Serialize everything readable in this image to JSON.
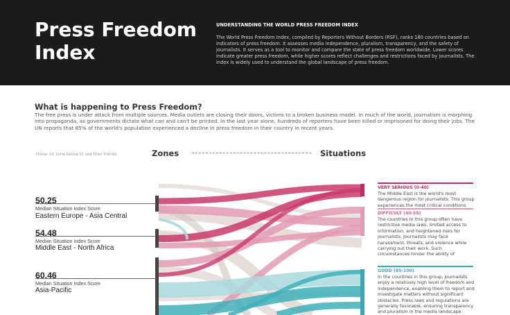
{
  "header": {
    "title": "Press Freedom Index",
    "subtitle": "UNDERSTANDING THE WORLD PRESS FREEDOM INDEX",
    "description": "The World Press Freedom Index, compiled by Reporters Without Borders (RSF), ranks 180 countries based on indicators of press freedom. It assesses media independence, pluralism, transparency, and the safety of journalists. It serves as a tool to monitor and compare the state of press freedom worldwide. Lower scores indicate greater press freedom, while higher scores reflect challenges and restrictions faced by journalists. The index is widely used to understand the global landscape of press freedom."
  },
  "intro": {
    "heading": "What is happening to Press Freedom?",
    "text": "The free press is under attack from multiple sources. Media outlets are closing their doors, victims to a broken business model. In much of the world, journalism is morphing into propaganda, as governments dictate what can and can't be printed. In the last year alone, hundreds of reporters have been killed or imprisoned for doing their jobs. The UN reports that 85% of the world's population experienced a decline in press freedom in their country in recent years."
  },
  "chart": {
    "hint": "Hover on zone below to see their trends",
    "zones_heading": "Zones",
    "situations_heading": "Situations",
    "zones": [
      {
        "score": "50.25",
        "caption": "Median Situation Index Score",
        "name": "Eastern Europe - Asia Central"
      },
      {
        "score": "54.48",
        "caption": "Median Situation Index Score",
        "name": "Middle East - North Africa"
      },
      {
        "score": "60.46",
        "caption": "Median Situation Index Score",
        "name": "Asia-Pacific"
      }
    ],
    "categories": [
      {
        "label": "VERY SERIOUS (0-40)",
        "color": "#c42a5d",
        "description": "The Middle East is the world's most dangerous region for journalists. This group experiences the most critical conditions."
      },
      {
        "label": "DIFFICULT (40-55)",
        "color": "#d45f86",
        "description": "The countries in this group often have restrictive media laws, limited access to information, and heightened risks for journalists. Journalists may face harassment, threats, and violence while carrying out their work. Such circumstances hinder the ability of journalists to freely report and contribute to public discourse."
      },
      {
        "label": "GOOD (85-100)",
        "color": "#3aa9b5",
        "description": "In the countries in this group, journalists enjoy a relatively high level of freedom and independence, enabling them to report and investigate matters without significant obstacles. Press laws and regulations are generally favorable, ensuring transparency and pluralism in the media landscape."
      }
    ],
    "colors": {
      "pink": "#c93a6b",
      "pink_light": "#e39ab3",
      "teal": "#3fb0ba",
      "teal_light": "#a9d9dd",
      "grey": "#d6ccc6"
    }
  }
}
